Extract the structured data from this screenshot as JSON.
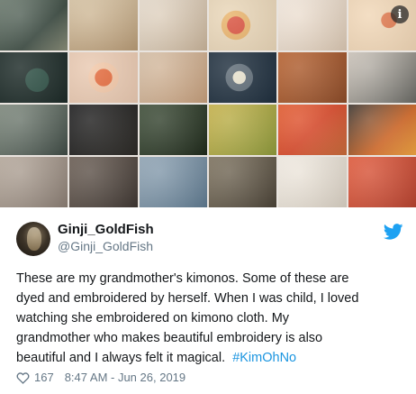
{
  "tweet": {
    "display_name": "Ginji_GoldFish",
    "handle": "@Ginji_GoldFish",
    "text_lines": [
      "These are my grandmother's kimonos.  Some of these are",
      "dyed and embroidered by herself.  When I was child, I loved",
      "watching she embroidered on kimono cloth. My",
      "grandmother who makes beautiful embroidery is also"
    ],
    "last_line_text": "beautiful and I always felt it magical.",
    "hashtag": "#KimOhNo",
    "likes": "167",
    "timestamp": "8:47 AM - Jun 26, 2019"
  },
  "media": {
    "info_label": "i"
  },
  "icons": {
    "info": "info-icon",
    "bird": "twitter-bird-icon",
    "like": "heart-icon",
    "avatar": "avatar"
  },
  "colors": {
    "link": "#1b95e0",
    "text": "#14171a",
    "muted": "#657786"
  }
}
